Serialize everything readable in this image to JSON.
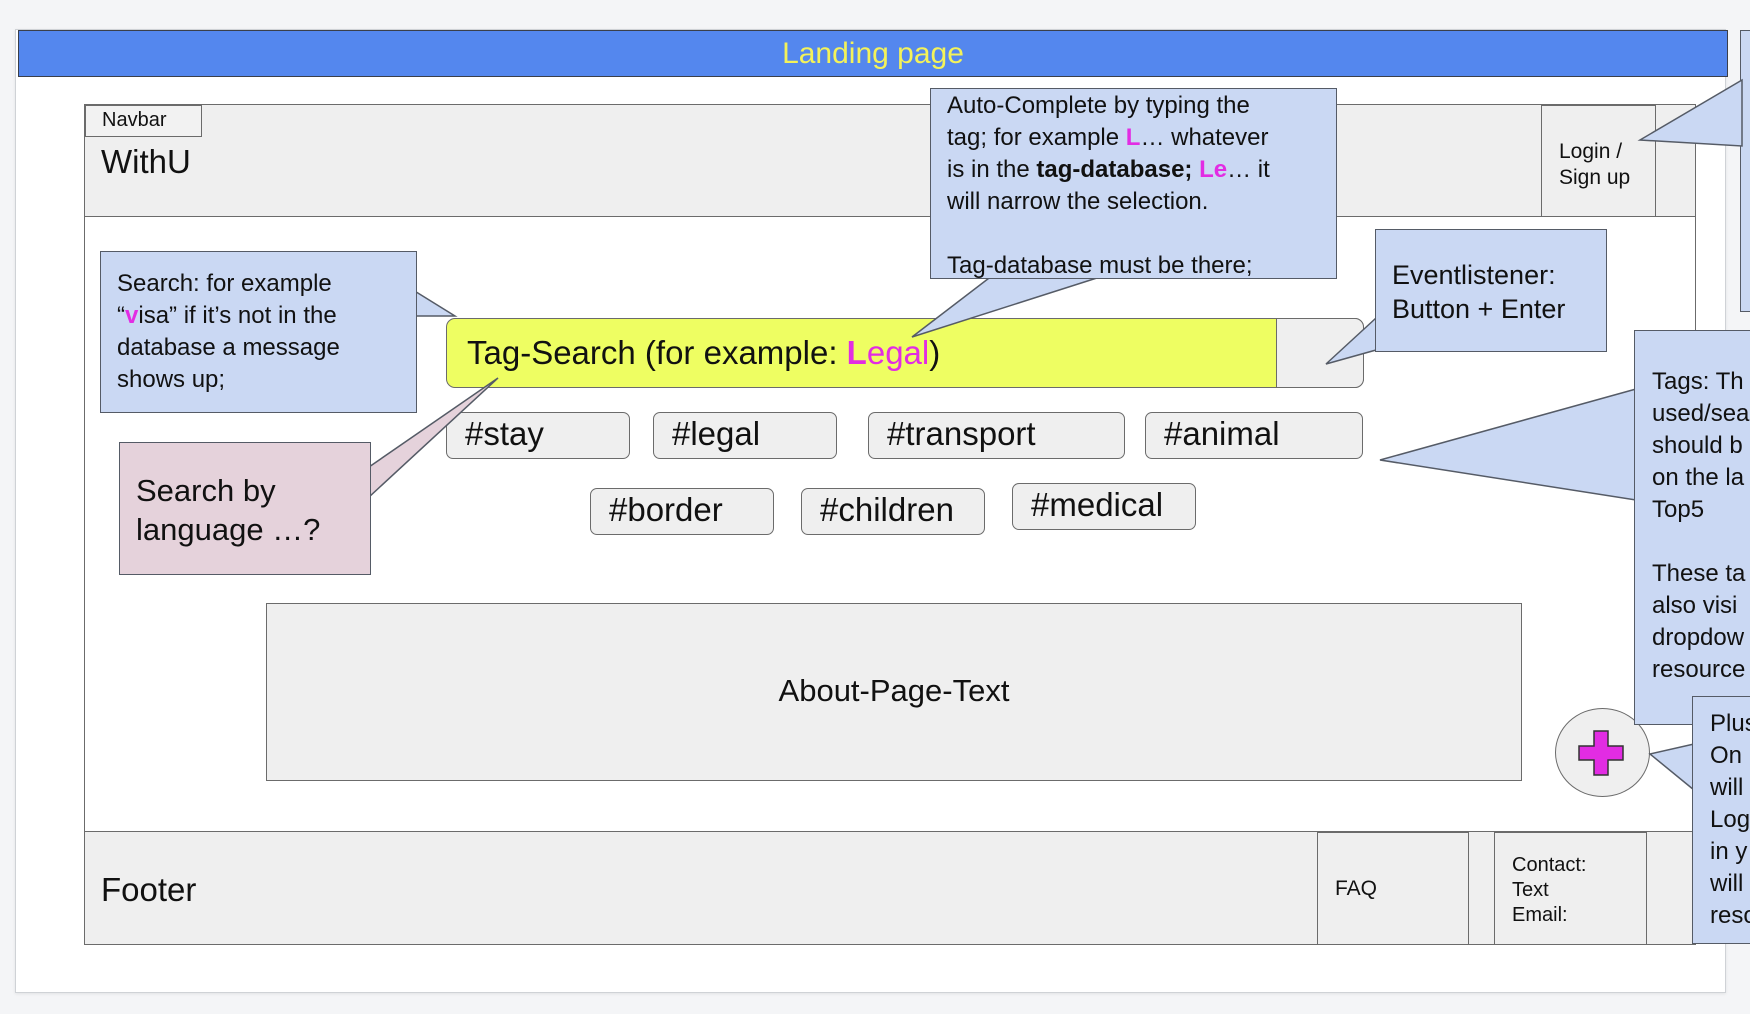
{
  "title": "Landing page",
  "navbar": {
    "tag": "Navbar",
    "brand": "WithU",
    "login": [
      "Login /",
      "Sign up"
    ]
  },
  "search": {
    "prefix": "Tag-Search (for example: ",
    "hl1": "L",
    "hl2": "egal",
    "suffix": ")"
  },
  "tags": [
    "#stay",
    "#legal",
    "#transport",
    "#animal",
    "#border",
    "#children",
    "#medical"
  ],
  "about": "About-Page-Text",
  "footer": {
    "label": "Footer",
    "faq": "FAQ",
    "contact": [
      "Contact:",
      "Text",
      "Email:"
    ]
  },
  "notes": {
    "autocomplete": {
      "l1": "Auto-Complete by typing the",
      "l2a": "tag; for example ",
      "l2b": "L",
      "l2c": "… whatever",
      "l3a": "is in the ",
      "l3b": "tag-database; ",
      "l3c": "Le",
      "l3d": "… it",
      "l4": "will narrow the selection.",
      "l5": "Tag-database must be there;"
    },
    "search": {
      "l1": "Search: for example",
      "l2a": "“",
      "l2b": "v",
      "l2c": "isa” if it’s not in the",
      "l3": "database a message",
      "l4": "shows up;"
    },
    "eventlistener": [
      "Eventlistener:",
      "Button + Enter"
    ],
    "language": [
      "Search by",
      "language …?"
    ],
    "tags": [
      "Tags: Th",
      "used/sea",
      "should b",
      "on the la",
      "Top5",
      "",
      "These ta",
      "also visi",
      "dropdow",
      "resource"
    ],
    "plus": [
      "Plus",
      "On",
      "will",
      "Log",
      "in y",
      "will",
      "reso"
    ]
  },
  "colors": {
    "title_bar": "#5487ee",
    "title_text": "#f3f25a",
    "search_bar": "#eefe62",
    "callout": "#cad8f3",
    "callout_pink": "#e5d2db",
    "highlight": "#e22ce3",
    "plus_icon": "#e22ce3"
  }
}
